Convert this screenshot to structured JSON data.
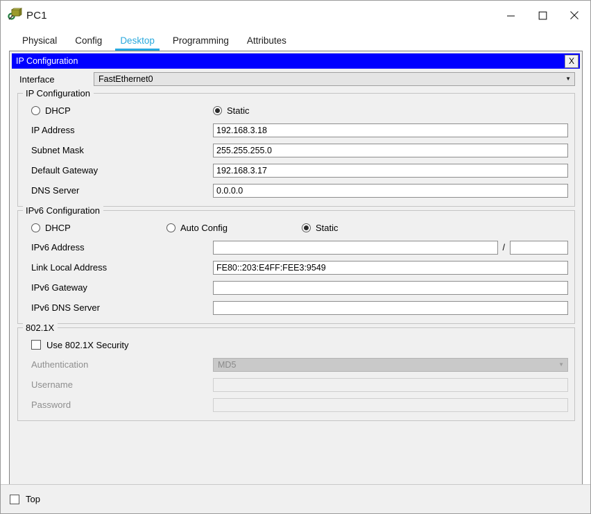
{
  "window": {
    "title": "PC1",
    "icon": "pc-device-icon",
    "controls": {
      "minimize": "minimize-icon",
      "maximize": "maximize-icon",
      "close": "close-icon"
    }
  },
  "tabs": [
    {
      "label": "Physical",
      "active": false
    },
    {
      "label": "Config",
      "active": false
    },
    {
      "label": "Desktop",
      "active": true
    },
    {
      "label": "Programming",
      "active": false
    },
    {
      "label": "Attributes",
      "active": false
    }
  ],
  "dialog": {
    "title": "IP Configuration",
    "close_label": "X",
    "title_bg": "#0000FF",
    "title_fg": "#FFFFFF"
  },
  "interface": {
    "label": "Interface",
    "value": "FastEthernet0",
    "caret": "▼"
  },
  "ip_configuration": {
    "legend": "IP Configuration",
    "modes": [
      {
        "label": "DHCP",
        "selected": false
      },
      {
        "label": "Static",
        "selected": true
      }
    ],
    "fields": [
      {
        "label": "IP Address",
        "value": "192.168.3.18",
        "disabled": false
      },
      {
        "label": "Subnet Mask",
        "value": "255.255.255.0",
        "disabled": false
      },
      {
        "label": "Default Gateway",
        "value": "192.168.3.17",
        "disabled": false
      },
      {
        "label": "DNS Server",
        "value": "0.0.0.0",
        "disabled": false
      }
    ]
  },
  "ipv6_configuration": {
    "legend": "IPv6 Configuration",
    "modes": [
      {
        "label": "DHCP",
        "selected": false
      },
      {
        "label": "Auto Config",
        "selected": false
      },
      {
        "label": "Static",
        "selected": true
      }
    ],
    "address": {
      "label": "IPv6 Address",
      "value": "",
      "separator": "/",
      "prefix": ""
    },
    "fields": [
      {
        "label": "Link Local Address",
        "value": "FE80::203:E4FF:FEE3:9549"
      },
      {
        "label": "IPv6 Gateway",
        "value": ""
      },
      {
        "label": "IPv6 DNS Server",
        "value": ""
      }
    ]
  },
  "dot1x": {
    "legend": "802.1X",
    "use_security": {
      "label": "Use 802.1X Security",
      "checked": false
    },
    "authentication": {
      "label": "Authentication",
      "value": "MD5",
      "caret": "▼",
      "disabled": true
    },
    "username": {
      "label": "Username",
      "value": "",
      "disabled": true
    },
    "password": {
      "label": "Password",
      "value": "",
      "disabled": true
    }
  },
  "bottom": {
    "top_checkbox": {
      "label": "Top",
      "checked": false
    }
  },
  "colors": {
    "accent": "#29A8DD",
    "dialog_title": "#0000FF",
    "panel_bg": "#F0F0F0",
    "field_border": "#8D8D8D",
    "disabled_combo": "#C9C9C9"
  }
}
